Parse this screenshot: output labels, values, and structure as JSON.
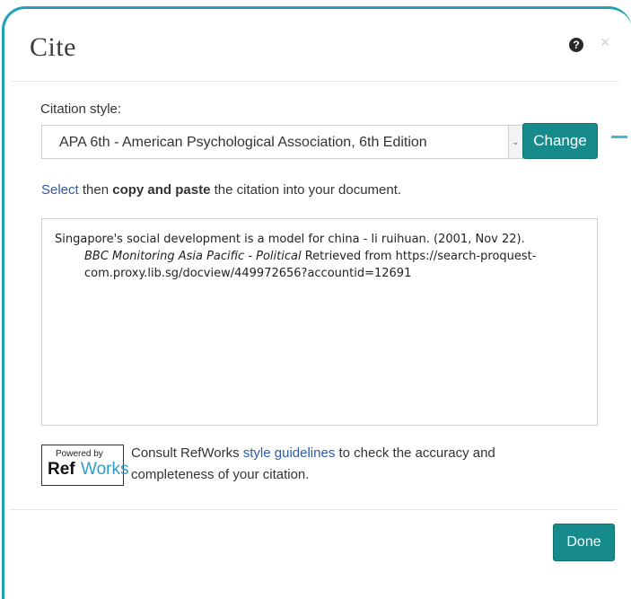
{
  "dialog": {
    "title": "Cite",
    "help_icon": "question-circle-icon",
    "close_icon": "close-icon",
    "close_glyph": "×"
  },
  "citation_style": {
    "label": "Citation style:",
    "selected": "APA 6th - American Psychological Association, 6th Edition",
    "change_label": "Change"
  },
  "instruction": {
    "select_link": "Select",
    "then": " then ",
    "bold": "copy and paste",
    "rest": " the citation into your document."
  },
  "citation": {
    "line1": "Singapore's social development is a model for china - li ruihuan. (2001, Nov 22).",
    "source_italic": "BBC Monitoring Asia Pacific - Political",
    "line2_rest": " Retrieved from https://search-proquest-",
    "line3": "com.proxy.lib.sg/docview/449972656?accountid=12691"
  },
  "refworks": {
    "powered_by": "Powered by",
    "ref": "Ref",
    "works": "Works",
    "consult_prefix": "Consult RefWorks ",
    "guidelines_link": "style guidelines",
    "consult_suffix": " to check the accuracy and completeness of your citation."
  },
  "footer": {
    "done_label": "Done"
  },
  "colors": {
    "accent": "#178a8c",
    "border_frame": "#20a2b8",
    "link": "#2a5ba8"
  }
}
